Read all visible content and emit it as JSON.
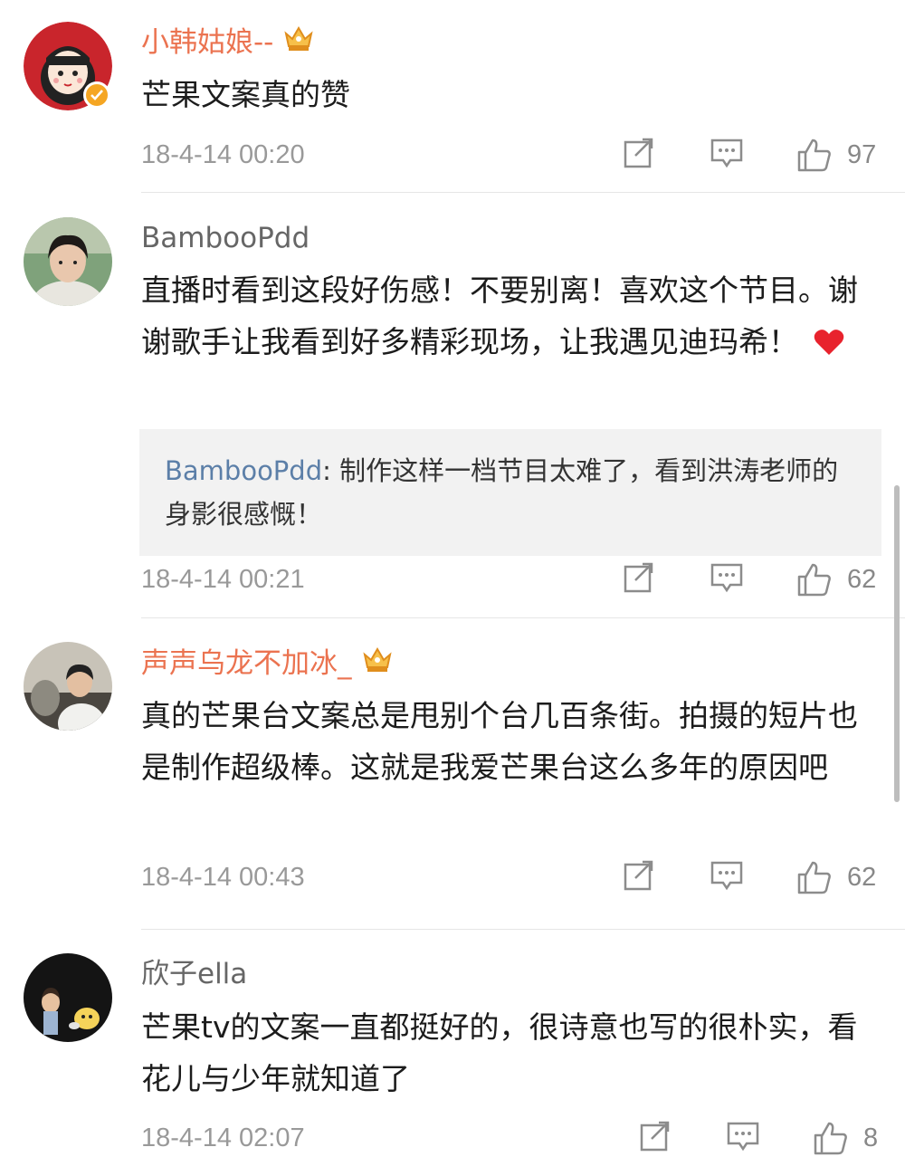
{
  "comments": [
    {
      "username": "小韩姑娘--",
      "text": "芒果文案真的赞",
      "timestamp": "18-4-14 00:20",
      "likes": "97",
      "vip_crown": true,
      "verified": true
    },
    {
      "username": "BambooPdd",
      "text": "直播时看到这段好伤感！不要别离！喜欢这个节目。谢谢歌手让我看到好多精彩现场，让我遇见迪玛希！",
      "reply": {
        "name": "BambooPdd",
        "separator": ":",
        "text": " 制作这样一档节目太难了，看到洪涛老师的身影很感慨！"
      },
      "timestamp": "18-4-14 00:21",
      "likes": "62"
    },
    {
      "username": "声声乌龙不加冰_",
      "text": "真的芒果台文案总是甩别个台几百条街。拍摄的短片也是制作超级棒。这就是我爱芒果台这么多年的原因吧",
      "timestamp": "18-4-14 00:43",
      "likes": "62",
      "vip_crown": true
    },
    {
      "username": "欣子ella",
      "text": "芒果tv的文案一直都挺好的，很诗意也写的很朴实，看花儿与少年就知道了",
      "timestamp": "18-4-14 02:07",
      "likes": "8"
    }
  ],
  "icons": {
    "repost": "repost-icon",
    "comment": "comment-icon",
    "like": "thumbs-up-icon",
    "crown": "crown-icon",
    "verified": "verified-badge-icon",
    "heart": "heart-icon"
  },
  "colors": {
    "vip_username": "#eb7350",
    "reply_name": "#5c7fa8",
    "crown": "#f2a623"
  }
}
